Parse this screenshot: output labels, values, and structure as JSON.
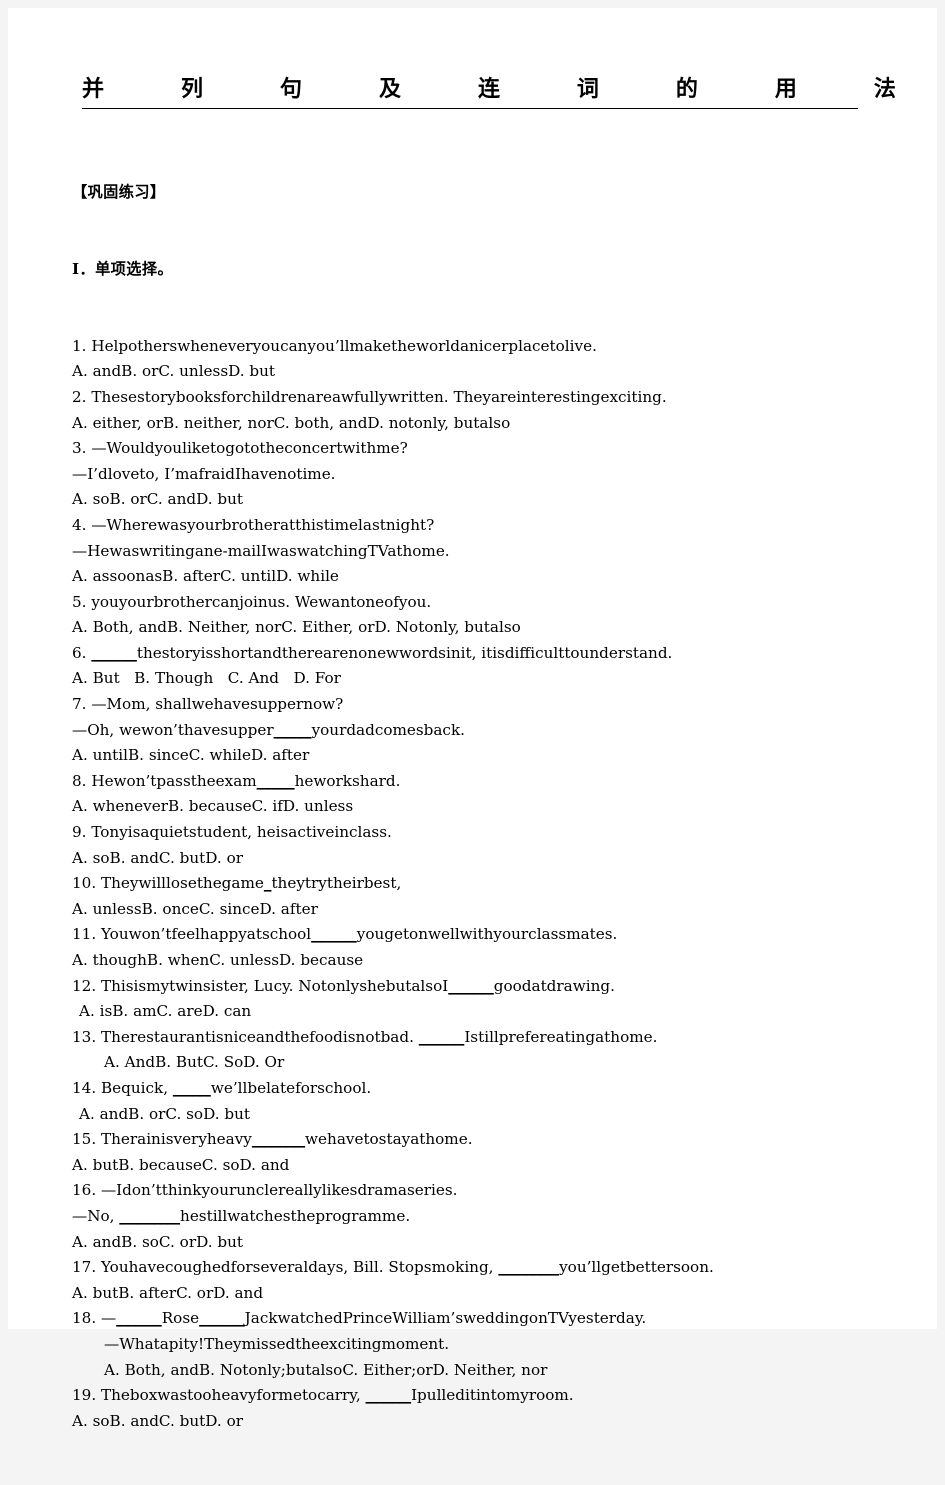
{
  "document": {
    "title_chars": [
      "并",
      "列",
      "句",
      "及",
      "连",
      "词",
      "的",
      "用",
      "法"
    ],
    "title_full": "并列句及连词的用法",
    "section_header": "【巩固练习】",
    "part_header": "I．单项选择。",
    "lines": [
      {
        "id": "q1",
        "indent": 0,
        "text": "1. Helpotherswheneveryoucanyou’llmaketheworldanicerplacetolive."
      },
      {
        "id": "q1-opts",
        "indent": 0,
        "text": "A. andB. orC. unlessD. but"
      },
      {
        "id": "q2",
        "indent": 0,
        "text": "2. Thesestorybooksforchildrenareawfullywritten. Theyareinterestingexciting."
      },
      {
        "id": "q2-opts",
        "indent": 0,
        "text": "A. either, orB. neither, norC. both, andD. notonly, butalso"
      },
      {
        "id": "q3",
        "indent": 0,
        "text": "3. —Wouldyouliketogototheconcertwithme?"
      },
      {
        "id": "q3-b",
        "indent": 0,
        "text": "—I’dloveto, I’mafraidIhavenotime."
      },
      {
        "id": "q3-opts",
        "indent": 0,
        "text": "A. soB. orC. andD. but"
      },
      {
        "id": "q4",
        "indent": 0,
        "text": "4. —Wherewasyourbrotheratthistimelastnight?"
      },
      {
        "id": "q4-b",
        "indent": 0,
        "text": "—Hewaswritingane-mailIwaswatchingTVathome."
      },
      {
        "id": "q4-opts",
        "indent": 0,
        "text": "A. assoonasB. afterC. untilD. while"
      },
      {
        "id": "q5",
        "indent": 0,
        "text": "5. youyourbrothercanjoinus. Wewantoneofyou."
      },
      {
        "id": "q5-opts",
        "indent": 0,
        "text": "A. Both, andB. Neither, norC. Either, orD. Notonly, butalso"
      },
      {
        "id": "q6",
        "indent": 0,
        "text": "6. ",
        "blank": "______",
        "text_after": "thestoryisshortandtherearenonewwordsinit, itisdifficulttounderstand."
      },
      {
        "id": "q6-opts",
        "indent": 0,
        "text": "A. But   B. Though   C. And   D. For"
      },
      {
        "id": "q7",
        "indent": 0,
        "text": "7. —Mom, shallwehavesuppernow?"
      },
      {
        "id": "q7-b",
        "indent": 0,
        "text": "—Oh, wewon’thavesupper",
        "blank": "_____",
        "text_after": "yourdadcomesback."
      },
      {
        "id": "q7-opts",
        "indent": 0,
        "text": "A. untilB. sinceC. whileD. after"
      },
      {
        "id": "q8",
        "indent": 0,
        "text": "8. Hewon’tpasstheexam",
        "blank": "_____",
        "text_after": "heworkshard."
      },
      {
        "id": "q8-opts",
        "indent": 0,
        "text": "A. wheneverB. becauseC. ifD. unless"
      },
      {
        "id": "q9",
        "indent": 0,
        "text": "9. Tonyisaquietstudent, heisactiveinclass."
      },
      {
        "id": "q9-opts",
        "indent": 0,
        "text": "A. soB. andC. butD. or"
      },
      {
        "id": "q10",
        "indent": 0,
        "text": "10. Theywilllosethegame",
        "blank": "_",
        "text_after": "theytrytheirbest,"
      },
      {
        "id": "q10-opts",
        "indent": 0,
        "text": "A. unlessB. onceC. sinceD. after"
      },
      {
        "id": "q11",
        "indent": 0,
        "text": "11. Youwon’tfeelhappyatschool",
        "blank": "______",
        "text_after": "yougetonwellwithyourclassmates."
      },
      {
        "id": "q11-opts",
        "indent": 0,
        "text": "A. thoughB. whenC. unlessD. because"
      },
      {
        "id": "q12",
        "indent": 0,
        "text": "12. Thisismytwinsister, Lucy. NotonlyshebutalsoI",
        "blank": "______",
        "text_after": "goodatdrawing."
      },
      {
        "id": "q12-opts",
        "indent": 1,
        "text": "A. isB. amC. areD. can"
      },
      {
        "id": "q13",
        "indent": 0,
        "text": "13. Therestaurantisniceandthefoodisnotbad. ",
        "blank": "______",
        "text_after": "Istillprefereatingathome."
      },
      {
        "id": "q13-opts",
        "indent": 2,
        "text": "A. AndB. ButC. SoD. Or"
      },
      {
        "id": "q14",
        "indent": 0,
        "text": "14. Bequick, ",
        "blank": "_____",
        "text_after": "we’llbelateforschool."
      },
      {
        "id": "q14-opts",
        "indent": 1,
        "text": "A. andB. orC. soD. but"
      },
      {
        "id": "q15",
        "indent": 0,
        "text": "15. Therainisveryheavy",
        "blank": "_______",
        "text_after": "wehavetostayathome."
      },
      {
        "id": "q15-opts",
        "indent": 0,
        "text": "A. butB. becauseC. soD. and"
      },
      {
        "id": "q16",
        "indent": 0,
        "text": "16. —Idon’tthinkyourunclereallylikesdramaseries."
      },
      {
        "id": "q16-b",
        "indent": 0,
        "text": "—No, ",
        "blank": "________",
        "text_after": "hestillwatchestheprogramme."
      },
      {
        "id": "q16-opts",
        "indent": 0,
        "text": "A. andB. soC. orD. but"
      },
      {
        "id": "q17",
        "indent": 0,
        "text": "17. Youhavecoughedforseveraldays, Bill. Stopsmoking, ",
        "blank": "________",
        "text_after": "you’llgetbettersoon."
      },
      {
        "id": "q17-opts",
        "indent": 0,
        "text": "A. butB. afterC. orD. and"
      },
      {
        "id": "q18",
        "indent": 0,
        "text": "18. —",
        "blank": "______",
        "text_after": "Rose",
        "blank2": "______",
        "text_after2": "JackwatchedPrinceWilliam’sweddingonTVyesterday."
      },
      {
        "id": "q18-b",
        "indent": 2,
        "text": "—Whatapity!Theymissedtheexcitingmoment."
      },
      {
        "id": "q18-opts",
        "indent": 2,
        "text": "A. Both, andB. Notonly;butalsoC. Either;orD. Neither, nor"
      },
      {
        "id": "q19",
        "indent": 0,
        "text": "19. Theboxwastooheavyformetocarry, ",
        "blank": "______",
        "text_after": "Ipulleditintomyroom."
      },
      {
        "id": "q19-opts",
        "indent": 0,
        "text": "A. soB. andC. butD. or"
      }
    ]
  },
  "colors": {
    "page_background": "#ffffff",
    "canvas_background": "#f4f4f4",
    "text": "#000000",
    "rule": "#000000"
  }
}
